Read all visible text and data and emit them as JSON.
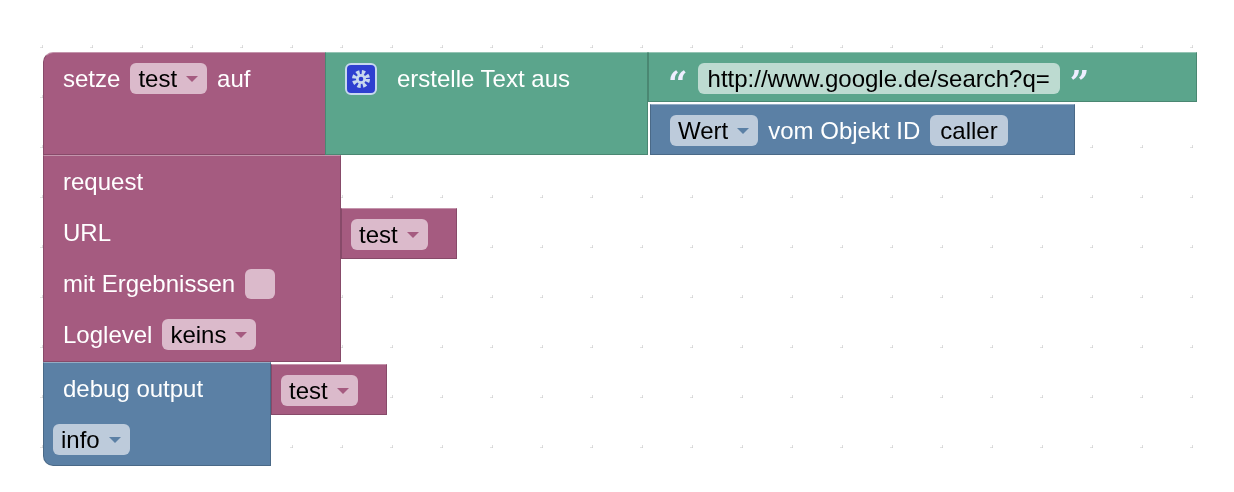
{
  "set_block": {
    "label": "setze",
    "variable": "test",
    "label_after": "auf"
  },
  "text_join": {
    "label": "erstelle Text aus",
    "items": [
      {
        "kind": "text",
        "open_quote": "“",
        "value": "http://www.google.de/search?q=",
        "close_quote": "”"
      },
      {
        "kind": "state",
        "property": "Wert",
        "label": "vom Objekt ID",
        "object_id": "caller"
      }
    ]
  },
  "request_block": {
    "title": "request",
    "url_label": "URL",
    "url_variable": "test",
    "results_label": "mit Ergebnissen",
    "results_checked": false,
    "loglevel_label": "Loglevel",
    "loglevel": "keins"
  },
  "debug_block": {
    "label": "debug output",
    "variable": "test",
    "log_level": "info"
  }
}
